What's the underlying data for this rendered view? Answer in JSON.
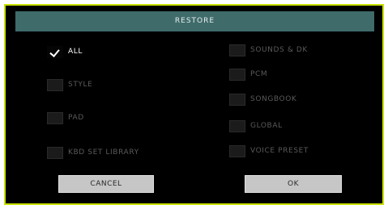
{
  "dialog": {
    "title": "RESTORE"
  },
  "options": {
    "all": {
      "label": "ALL",
      "checked": true
    },
    "style": {
      "label": "STYLE",
      "checked": false
    },
    "pad": {
      "label": "PAD",
      "checked": false
    },
    "kbd_set_library": {
      "label": "KBD SET LIBRARY",
      "checked": false
    },
    "sounds_dk": {
      "label": "SOUNDS & DK",
      "checked": false
    },
    "pcm": {
      "label": "PCM",
      "checked": false
    },
    "songbook": {
      "label": "SONGBOOK",
      "checked": false
    },
    "global": {
      "label": "GLOBAL",
      "checked": false
    },
    "voice_preset": {
      "label": "VOICE PRESET",
      "checked": false
    }
  },
  "buttons": {
    "cancel": "CANCEL",
    "ok": "OK"
  },
  "colors": {
    "frame": "#c8e000",
    "titlebar": "#3f6b6b",
    "background": "#000000",
    "button": "#c6c6c6"
  }
}
